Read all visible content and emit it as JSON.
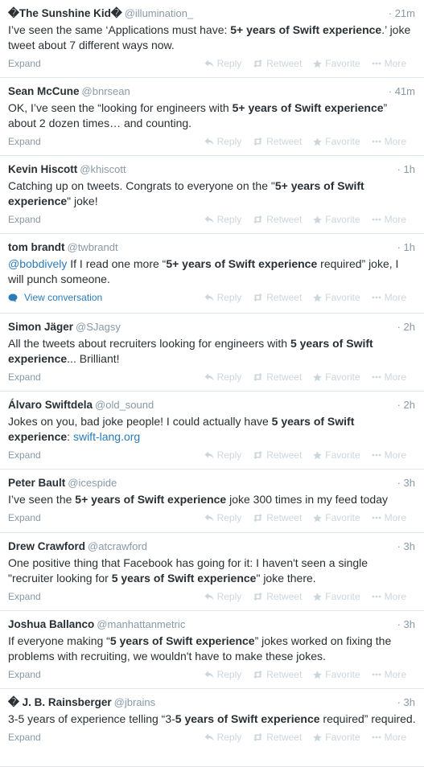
{
  "actions": {
    "reply": "Reply",
    "retweet": "Retweet",
    "favorite": "Favorite",
    "more": "More",
    "expand": "Expand",
    "view_conversation": "View conversation"
  },
  "colors": {
    "link": "#2b7bb9",
    "muted": "#8899a6",
    "action": "#ccd6dd",
    "divider": "#e1e8ed"
  },
  "tweets": [
    {
      "fullname": "�The Sunshine Kid�",
      "username": "@illumination_",
      "time": "· 21m",
      "parts": [
        [
          "t",
          "I’ve seen the same ‘Applications must have: "
        ],
        [
          "b",
          "5+ years of Swift experience"
        ],
        [
          "t",
          ".’ joke tweet about 7 different ways now."
        ]
      ],
      "footer": "expand"
    },
    {
      "fullname": "Sean McCune",
      "username": "@bnrsean",
      "time": "· 41m",
      "parts": [
        [
          "t",
          "OK, I’ve seen the “looking for engineers with "
        ],
        [
          "b",
          "5+ years of Swift experience"
        ],
        [
          "t",
          "” about 2 dozen times… and counting."
        ]
      ],
      "footer": "expand"
    },
    {
      "fullname": "Kevin Hiscott",
      "username": "@khiscott",
      "time": "· 1h",
      "parts": [
        [
          "t",
          "Catching up on tweets. Congrats to everyone on the \""
        ],
        [
          "b",
          "5+ years of Swift experience"
        ],
        [
          "t",
          "\" joke!"
        ]
      ],
      "footer": "expand"
    },
    {
      "fullname": "tom brandt",
      "username": "@twbrandt",
      "time": "· 1h",
      "parts": [
        [
          "a",
          "@bobdively"
        ],
        [
          "t",
          " If I read one more “"
        ],
        [
          "b",
          "5+ years of Swift experience"
        ],
        [
          "t",
          " required” joke, I will punch someone."
        ]
      ],
      "footer": "conversation"
    },
    {
      "fullname": "Simon Jäger",
      "username": "@SJagsy",
      "time": "· 2h",
      "parts": [
        [
          "t",
          "All the tweets about recruiters looking for engineers with "
        ],
        [
          "b",
          "5 years of Swift experience"
        ],
        [
          "t",
          "... Brilliant!"
        ]
      ],
      "footer": "expand"
    },
    {
      "fullname": "Álvaro Swiftdela",
      "username": "@old_sound",
      "time": "· 2h",
      "parts": [
        [
          "t",
          "Jokes on you, bad joke people! I could actually have "
        ],
        [
          "b",
          "5 years of Swift experience"
        ],
        [
          "t",
          ": "
        ],
        [
          "a",
          "swift-lang.org"
        ]
      ],
      "footer": "expand"
    },
    {
      "fullname": "Peter Bault",
      "username": "@icespide",
      "time": "· 3h",
      "parts": [
        [
          "t",
          "I’ve seen the "
        ],
        [
          "b",
          "5+ years of Swift experience"
        ],
        [
          "t",
          " joke 300 times in my feed today"
        ]
      ],
      "footer": "expand"
    },
    {
      "fullname": "Drew Crawford",
      "username": "@atcrawford",
      "time": "· 3h",
      "parts": [
        [
          "t",
          "One positive thing that Facebook has going for it: I haven't seen a single \"recruiter looking for "
        ],
        [
          "b",
          "5 years of Swift experience"
        ],
        [
          "t",
          "\" joke there."
        ]
      ],
      "footer": "expand"
    },
    {
      "fullname": "Joshua Ballanco",
      "username": "@manhattanmetric",
      "time": "· 3h",
      "parts": [
        [
          "t",
          "If everyone making “"
        ],
        [
          "b",
          "5 years of Swift experience"
        ],
        [
          "t",
          "” jokes worked on fixing the problems with recruiting, we wouldn't have to make these jokes."
        ]
      ],
      "footer": "expand"
    },
    {
      "fullname": "� J. B. Rainsberger",
      "username": "@jbrains",
      "time": "· 3h",
      "parts": [
        [
          "t",
          "3-5 years of experience telling “3-"
        ],
        [
          "b",
          "5 years of Swift experience"
        ],
        [
          "t",
          " required” required."
        ]
      ],
      "footer": "expand"
    }
  ]
}
